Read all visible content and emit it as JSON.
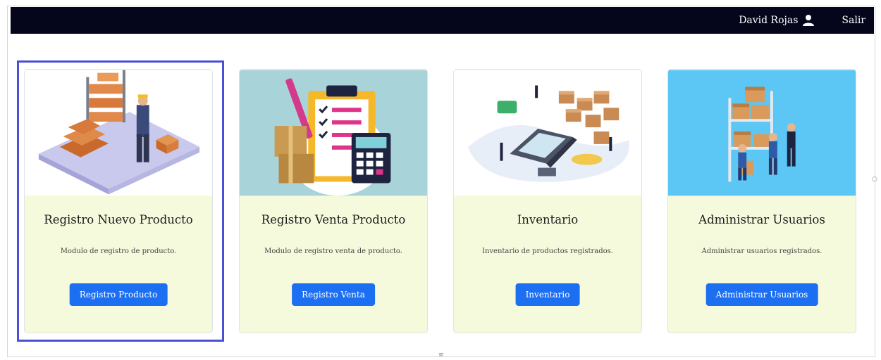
{
  "navbar": {
    "user_name": "David Rojas",
    "exit_label": "Salir"
  },
  "cards": [
    {
      "title": "Registro Nuevo Producto",
      "description": "Modulo de registro de producto.",
      "button_label": "Registro Producto",
      "image_icon": "warehouse-worker-illustration"
    },
    {
      "title": "Registro Venta Producto",
      "description": "Modulo de registro venta de producto.",
      "button_label": "Registro Venta",
      "image_icon": "clipboard-calculator-illustration"
    },
    {
      "title": "Inventario",
      "description": "Inventario de productos registrados.",
      "button_label": "Inventario",
      "image_icon": "inventory-laptop-illustration"
    },
    {
      "title": "Administrar Usuarios",
      "description": "Administrar usuarios registrados.",
      "button_label": "Administrar Usuarios",
      "image_icon": "users-shelves-illustration"
    }
  ],
  "colors": {
    "navbar_bg": "#05051c",
    "card_body_bg": "#f4fadb",
    "button_bg": "#1d6ff2",
    "selection_border": "#4a4fd6"
  }
}
